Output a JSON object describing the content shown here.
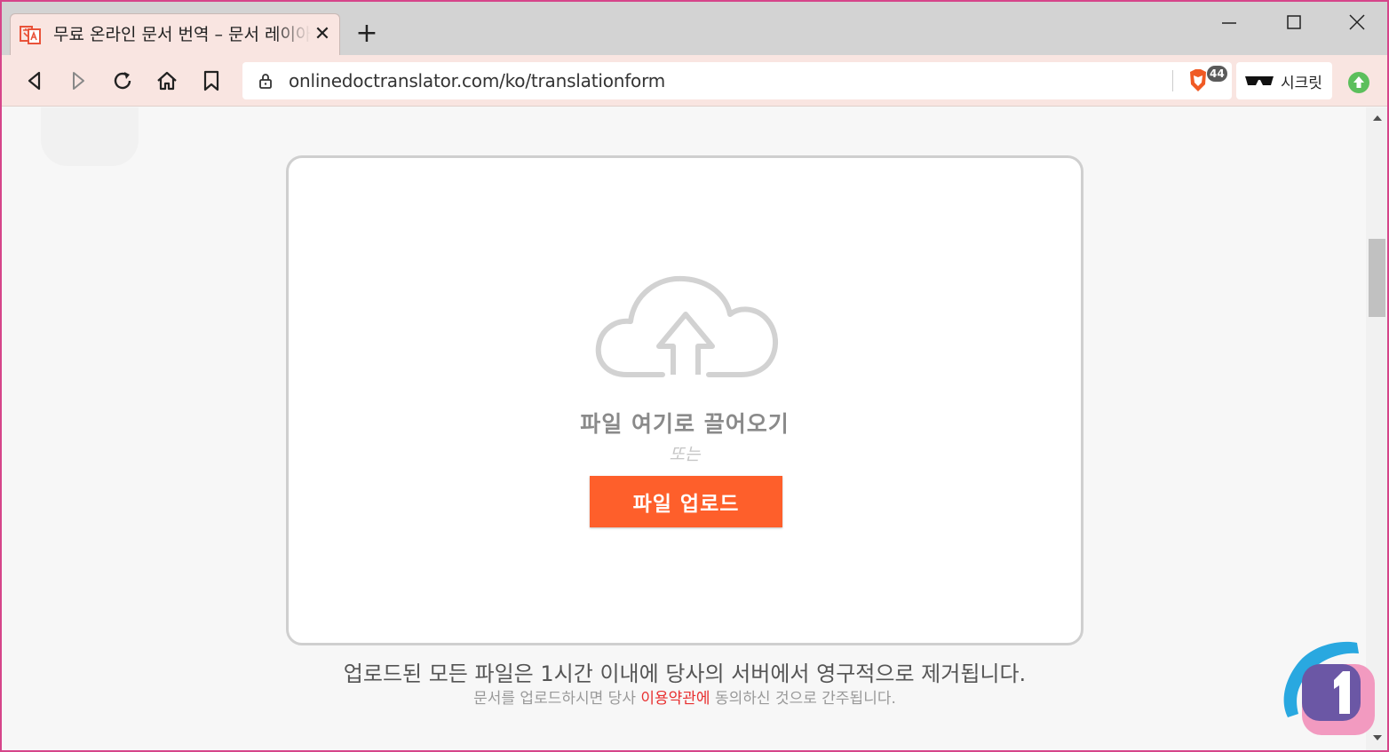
{
  "browser": {
    "tab": {
      "title": "무료 온라인 문서 번역 – 문서 레이아웃 유지",
      "close": "✕",
      "favicon": "translate-favicon-icon"
    },
    "new_tab": "+",
    "window_controls": [
      "minimize-icon",
      "maximize-icon",
      "close-icon"
    ],
    "toolbar": {
      "buttons": [
        "back-icon",
        "forward-icon",
        "reload-icon",
        "home-icon",
        "bookmark-icon"
      ],
      "url": "onlinedoctranslator.com/ko/translationform",
      "brave_shield_count": "44",
      "incognito_label": "시크릿"
    }
  },
  "page": {
    "dropzone": {
      "drag_text": "파일 여기로 끌어오기",
      "or_text": "또는",
      "upload_button": "파일 업로드"
    },
    "notice": {
      "main": "업로드된 모든 파일은 1시간 이내에 당사의 서버에서 영구적으로 제거됩니다.",
      "sub_before": "문서를 업로드하시면 당사 ",
      "terms_link": "이용약관에",
      "sub_after": " 동의하신 것으로 간주됩니다."
    }
  },
  "colors": {
    "accent": "#fe5f2b",
    "link": "#e83030",
    "frame": "#d6458a",
    "toolbar_bg": "#f9e5e1"
  }
}
